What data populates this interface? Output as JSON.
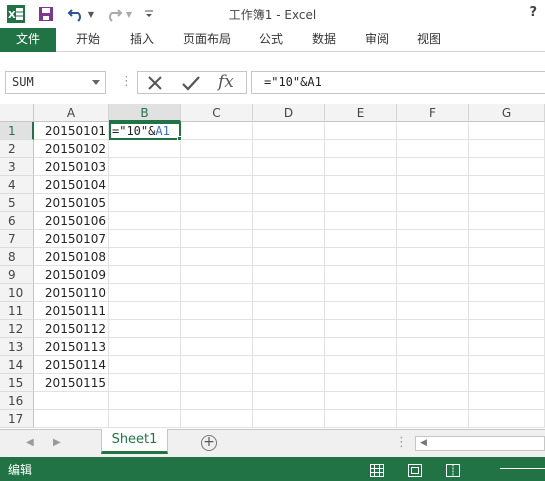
{
  "window": {
    "title": "工作簿1 - Excel",
    "help": "?"
  },
  "colors": {
    "accent": "#217346",
    "grid": "#e2e2e2",
    "header_bg": "#f3f3f3",
    "ref_blue": "#3a6fc4"
  },
  "ribbon": {
    "tabs": [
      "文件",
      "开始",
      "插入",
      "页面布局",
      "公式",
      "数据",
      "审阅",
      "视图"
    ]
  },
  "formula_bar": {
    "name_box": "SUM",
    "formula": "=\"10\"&A1"
  },
  "columns": [
    "A",
    "B",
    "C",
    "D",
    "E",
    "F",
    "G"
  ],
  "rows": [
    "1",
    "2",
    "3",
    "4",
    "5",
    "6",
    "7",
    "8",
    "9",
    "10",
    "11",
    "12",
    "13",
    "14",
    "15",
    "16",
    "17"
  ],
  "cells": {
    "A": [
      "20150101",
      "20150102",
      "20150103",
      "20150104",
      "20150105",
      "20150106",
      "20150107",
      "20150108",
      "20150109",
      "20150110",
      "20150111",
      "20150112",
      "20150113",
      "20150114",
      "20150115"
    ],
    "B1": {
      "prefix": "=\"10\"&",
      "ref": "A1"
    }
  },
  "active_cell": "B1",
  "sheets": [
    "Sheet1"
  ],
  "status": {
    "mode": "编辑"
  },
  "icons": [
    "excel-logo-icon",
    "save-icon",
    "undo-icon",
    "redo-icon",
    "customize-qat-icon",
    "cancel-icon",
    "enter-icon",
    "insert-function-icon",
    "add-sheet-icon",
    "normal-view-icon",
    "page-layout-view-icon",
    "page-break-view-icon"
  ]
}
